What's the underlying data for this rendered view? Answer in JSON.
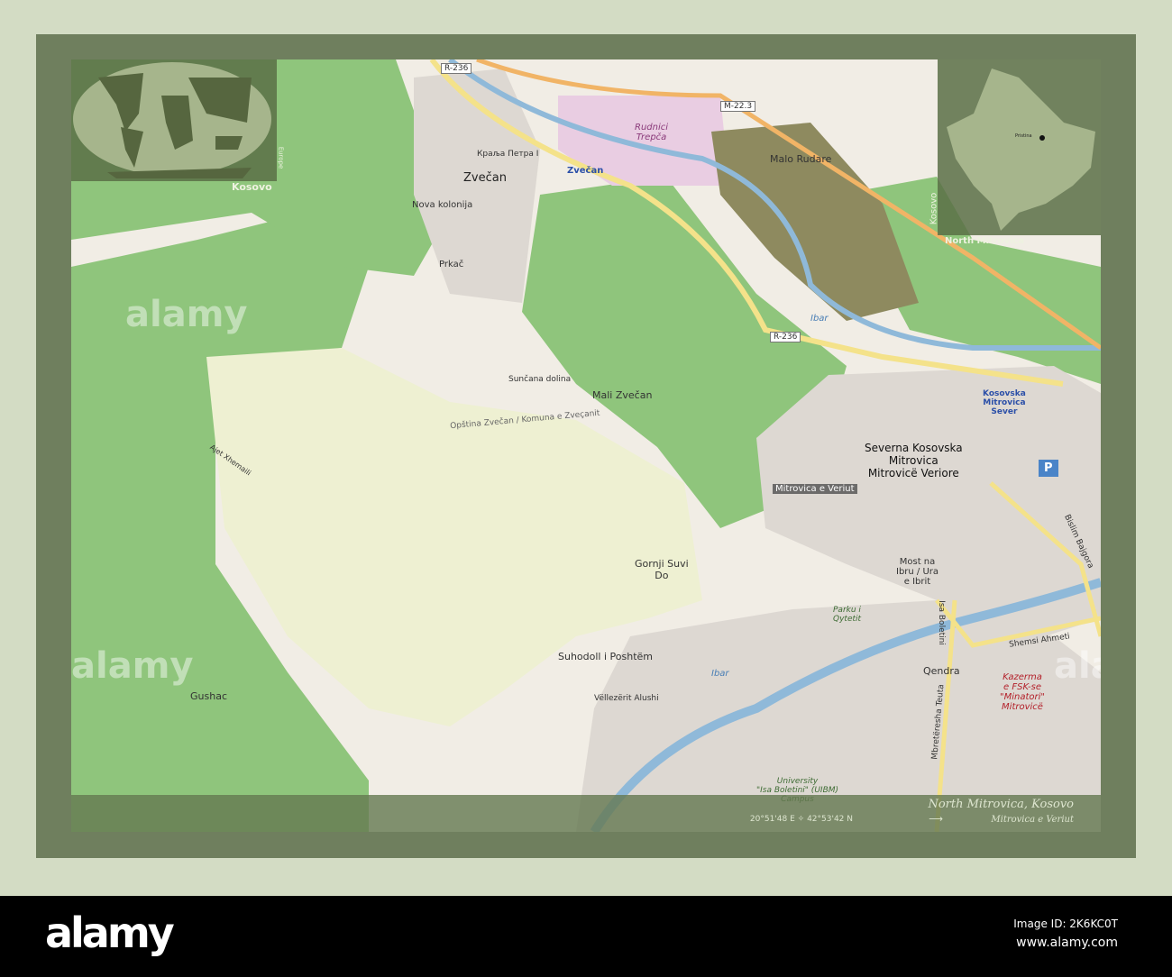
{
  "map": {
    "title": "North Mitrovica, Kosovo",
    "coordinates": "20°51'48 E ✧ 42°53'42 N",
    "arrow": "⟶",
    "local_name": "Mitrovica e Veriut",
    "world_inset": {
      "region_label": "Kosovo",
      "continent_label": "Europe"
    },
    "country_inset": {
      "country_label": "Kosovo",
      "region_label": "North Mitrovica",
      "capital": "Pristina"
    },
    "places": {
      "zvecan": "Zvečan",
      "zvecan_station": "Zvečan",
      "malo_rudare": "Malo Rudare",
      "rudnici": "Rudnici\nTrepča",
      "nova_kolonija": "Nova kolonija",
      "prkac": "Prkač",
      "suncana": "Sunčana dolina",
      "mali_zvecan": "Mali Zvečan",
      "severna": "Severna Kosovska\nMitrovica\nMitrovicë Veriore",
      "mitrovica_veriut": "Mitrovica e Veriut",
      "kosovska_sever": "Kosovska\nMitrovica\nSever",
      "gornji": "Gornji Suvi\nDo",
      "suhodoll": "Suhodoll i Poshtëm",
      "gushac": "Gushac",
      "qendra": "Qendra",
      "most": "Most na\nIbru / Ura\ne Ibrit",
      "parku": "Parku i\nQytetit",
      "university": "University\n\"Isa Boletini\" (UIBM)\nCampus",
      "kazerma": "Kazerma\ne FSK-se\n\"Minatori\"\nMitrovicë",
      "ibar1": "Ibar",
      "ibar2": "Ibar",
      "opstina": "Opština Zvečan / Komuna e Zveçanit",
      "shemsi": "Shemsi Ahmeti",
      "bislim": "Bislim Bajgora",
      "velezerit": "Vëllezërit Alushi",
      "isa_boletini": "Isa Boletini",
      "mbreteresha": "Mbretëresha Teuta",
      "ajet": "Ajet Xhemaili",
      "kraljapetra": "Краља Петра I",
      "parking": "P"
    },
    "roads": {
      "r236a": "R-236",
      "r236b": "R-236",
      "m22": "M-22.3"
    }
  },
  "watermark": {
    "logo": "alamy",
    "image_id": "Image ID: 2K6KC0T",
    "url": "www.alamy.com"
  }
}
